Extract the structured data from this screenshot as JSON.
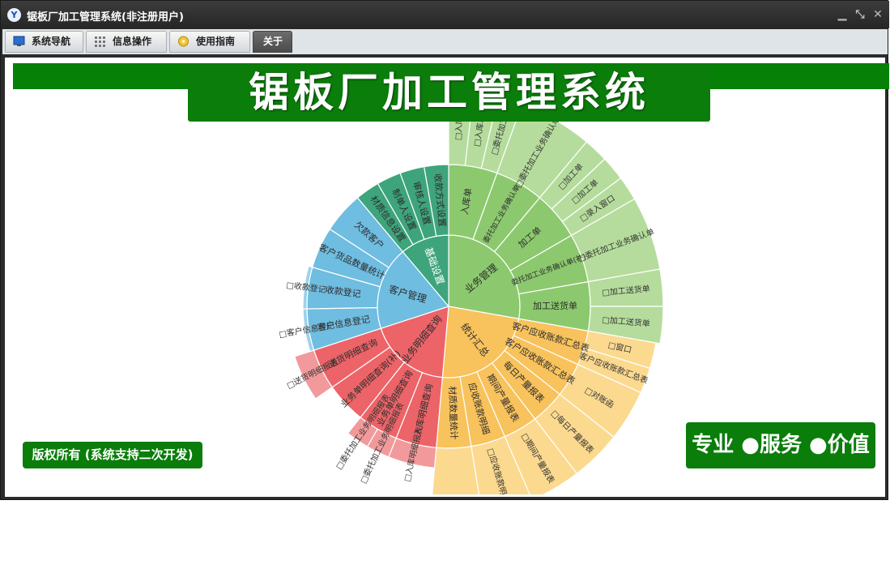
{
  "window": {
    "icon_letter": "Y",
    "title": "锯板厂加工管理系统(非注册用户)",
    "controls": {
      "minimize": "▁",
      "restore": "⤡",
      "close": "✕"
    }
  },
  "menu": {
    "tabs": [
      {
        "label": "系统导航",
        "icon": "monitor-icon"
      },
      {
        "label": "信息操作",
        "icon": "grid-icon"
      },
      {
        "label": "使用指南",
        "icon": "help-icon"
      },
      {
        "label": "关于",
        "icon": "",
        "active": true
      }
    ]
  },
  "banner": {
    "title": "锯板厂加工管理系统"
  },
  "copyright": "版权所有 (系统支持二次开发)",
  "slogan": "专业 ●服务 ●价值",
  "colors": {
    "titlebar": "#2b2b2b",
    "banner_green": "#0a7d0a",
    "business": "#8cc96e",
    "stats": "#f8c25c",
    "detail": "#ec6468",
    "customer": "#6fbde0",
    "settings": "#3ea47c"
  },
  "sunburst": {
    "sectors": [
      {
        "name": "业务管理",
        "color": "#8cc96e",
        "light": "#b5dc9c",
        "children": [
          {
            "name": "入库单",
            "items": [
              "□入库",
              "□入库单",
              "□委托加工"
            ]
          },
          {
            "name": "委托加工业务确认单",
            "items": [
              "□委托加工业务确认单"
            ]
          },
          {
            "name": "加工单",
            "items": [
              "□加工单",
              "□加工单",
              "□录入窗口"
            ]
          },
          {
            "name": "委托加工业务确认单(补)",
            "items": [
              "□委托加工业务确认单"
            ]
          },
          {
            "name": "加工送货单",
            "items": [
              "□加工送货单",
              "□加工送货单"
            ]
          }
        ]
      },
      {
        "name": "统计汇总",
        "color": "#f8c25c",
        "light": "#fbd98f",
        "children": [
          {
            "name": "客户应收账款汇总表",
            "items": [
              "□窗口",
              "客户应收账款汇总表"
            ]
          },
          {
            "name": "客户应收账款汇总表",
            "items": [
              "□对账函"
            ]
          },
          {
            "name": "每日产量报表",
            "items": [
              "□每日产量报表"
            ]
          },
          {
            "name": "期间产量报表",
            "items": [
              "□期间产量报表"
            ]
          },
          {
            "name": "应收账款明细",
            "items": [
              "□应收账款明细"
            ]
          },
          {
            "name": "材质数量统计",
            "items": []
          }
        ]
      },
      {
        "name": "业务明细查询",
        "color": "#ec6468",
        "light": "#f29a9b",
        "children": [
          {
            "name": "入库明细查询",
            "items": [
              "□入库明细报表"
            ]
          },
          {
            "name": "业务单明细查询",
            "items": [
              "□委托加工业务明细报表",
              "□委托加工业务明细报表"
            ]
          },
          {
            "name": "业务单明细查询(补)",
            "items": []
          },
          {
            "name": "送货明细查询",
            "items": [
              "□送货明细报表"
            ]
          }
        ]
      },
      {
        "name": "客户管理",
        "color": "#6fbde0",
        "light": "#9dd2eb",
        "children": [
          {
            "name": "客户信息登记",
            "items": [
              "□客户信息登记"
            ]
          },
          {
            "name": "收款登记",
            "items": [
              "□收款登记"
            ]
          },
          {
            "name": "客户货品数量统计",
            "items": []
          },
          {
            "name": "欠款客户",
            "items": []
          }
        ]
      },
      {
        "name": "基础设置",
        "color": "#3ea47c",
        "light": "#5cb48f",
        "children": [
          {
            "name": "材质信息设置",
            "items": []
          },
          {
            "name": "制单人设置",
            "items": []
          },
          {
            "name": "审核人设置",
            "items": []
          },
          {
            "name": "收款方式设置",
            "items": []
          }
        ]
      }
    ]
  }
}
